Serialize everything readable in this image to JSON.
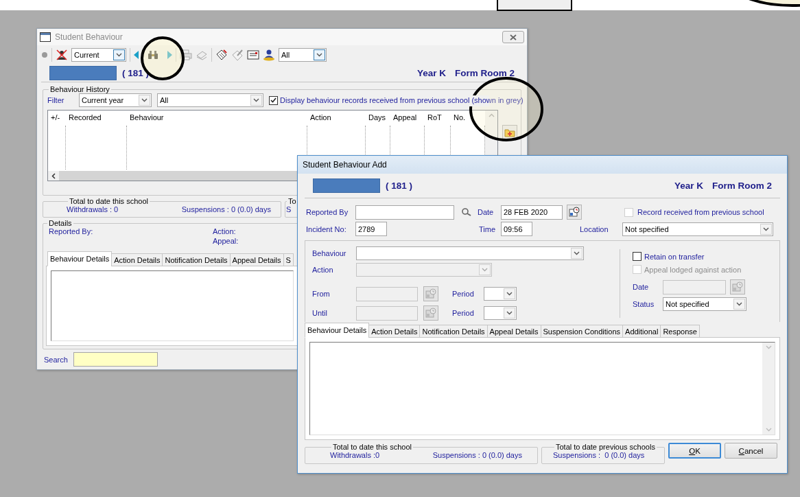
{
  "student_behaviour_window": {
    "title": "Student Behaviour",
    "toolbar": {
      "period": "Current",
      "staff": "All"
    },
    "student": {
      "count": "( 181 )",
      "year": "Year K",
      "form": "Form Room 2"
    },
    "history": {
      "legend": "Behaviour History",
      "filter_label": "Filter",
      "year_filter": "Current year",
      "type_filter": "All",
      "show_previous": {
        "label": "Display behaviour records received from previous school (shown in grey)",
        "checked": true
      },
      "columns": [
        "+/-",
        "Recorded",
        "Behaviour",
        "Action",
        "Days",
        "Appeal",
        "RoT",
        "No."
      ]
    },
    "totals_this_school": {
      "legend": "Total to date this school",
      "withdrawals": "Withdrawals : 0",
      "suspensions": "Suspensions : 0 (0.0) days"
    },
    "totals_previous": {
      "legend": "To",
      "suspensions": "S"
    },
    "details": {
      "legend": "Details",
      "reported_by": "Reported By:",
      "action": "Action:",
      "appeal": "Appeal:",
      "tabs": [
        {
          "label": "Behaviour Details",
          "selected": true
        },
        {
          "label": "Action Details",
          "selected": false
        },
        {
          "label": "Notification Details",
          "selected": false
        },
        {
          "label": "Appeal Details",
          "selected": false
        },
        {
          "label": "S",
          "selected": false
        }
      ]
    },
    "search": {
      "label": "Search"
    }
  },
  "add_window": {
    "title": "Student Behaviour Add",
    "student": {
      "count": "( 181 )",
      "year": "Year K",
      "form": "Form Room 2"
    },
    "reported_by": {
      "label": "Reported By"
    },
    "date": {
      "label": "Date",
      "value": "28 FEB 2020"
    },
    "previous_school": {
      "label": "Record received from previous school",
      "checked": false
    },
    "incident": {
      "label": "Incident No:",
      "value": "2789"
    },
    "time": {
      "label": "Time",
      "value": "09:56"
    },
    "location": {
      "label": "Location",
      "value": "Not specified"
    },
    "behaviour": {
      "label": "Behaviour",
      "disabled": false
    },
    "action": {
      "label": "Action",
      "disabled": true
    },
    "from": {
      "label": "From",
      "disabled": true,
      "period_label": "Period"
    },
    "until": {
      "label": "Until",
      "disabled": true,
      "period_label": "Period"
    },
    "retain": {
      "label": "Retain on transfer",
      "checked": false,
      "disabled": false
    },
    "appeal": {
      "label": "Appeal lodged against action",
      "checked": false,
      "disabled": true
    },
    "appeal_date": {
      "label": "Date",
      "disabled": true
    },
    "status": {
      "label": "Status",
      "value": "Not specified"
    },
    "tabs": [
      {
        "label": "Behaviour Details",
        "selected": true
      },
      {
        "label": "Action Details",
        "selected": false
      },
      {
        "label": "Notification Details",
        "selected": false
      },
      {
        "label": "Appeal Details",
        "selected": false
      },
      {
        "label": "Suspension Conditions",
        "selected": false
      },
      {
        "label": "Additional",
        "selected": false
      },
      {
        "label": "Response",
        "selected": false
      }
    ],
    "totals_this_school": {
      "legend": "Total to date this school",
      "withdrawals": "Withdrawals :0",
      "suspensions": "Suspensions : 0 (0.0) days"
    },
    "totals_previous": {
      "legend": "Total to date previous schools",
      "suspensions": "Suspensions :  0 (0.0) days"
    },
    "buttons": [
      {
        "label": "OK",
        "default": true
      },
      {
        "label": "Cancel",
        "default": false
      }
    ]
  }
}
